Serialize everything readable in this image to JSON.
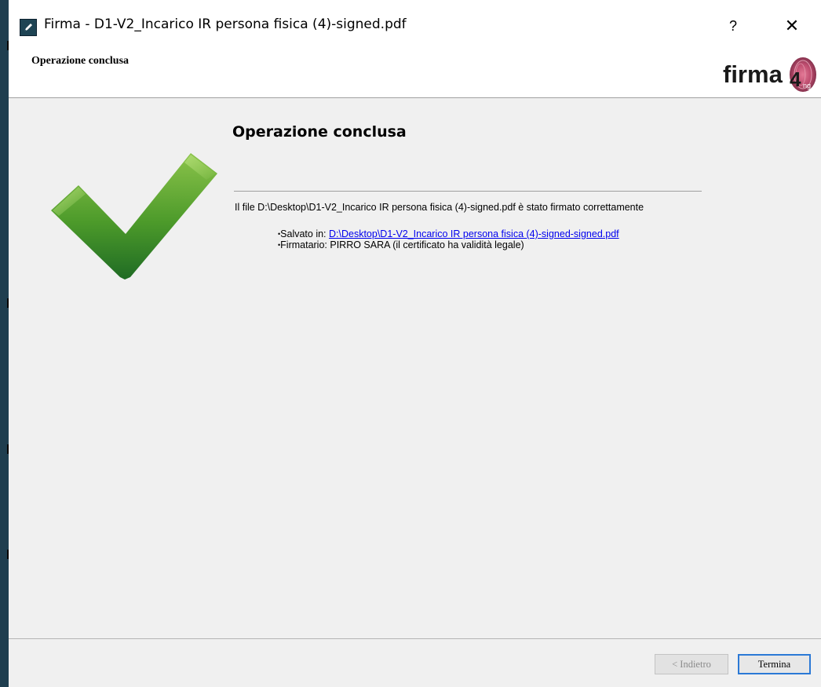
{
  "window": {
    "title": "Firma - D1-V2_Incarico IR persona fisica (4)-signed.pdf",
    "help_label": "?",
    "close_label": "✕"
  },
  "header": {
    "title": "Operazione conclusa",
    "logo_text": "firma4",
    "logo_sub": "ng"
  },
  "content": {
    "title": "Operazione conclusa",
    "message": "Il file D:\\Desktop\\D1-V2_Incarico IR persona fisica (4)-signed.pdf è stato firmato correttamente",
    "bullet_char": "•",
    "saved_label": "Salvato in: ",
    "saved_path": "D:\\Desktop\\D1-V2_Incarico IR persona fisica (4)-signed-signed.pdf",
    "signer_text": "Firmatario: PIRRO SARA (il certificato ha validità legale)"
  },
  "footer": {
    "back_label": "< Indietro",
    "finish_label": "Termina"
  },
  "colors": {
    "check_light": "#8bc34a",
    "check_dark": "#2e7d32",
    "link": "#0000ee",
    "focus_border": "#2b79d6"
  }
}
